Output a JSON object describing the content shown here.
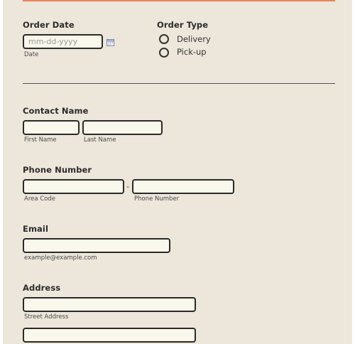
{
  "order_date": {
    "label": "Order Date",
    "placeholder": "mm-dd-yyyy",
    "value": "",
    "sublabel": "Date"
  },
  "order_type": {
    "label": "Order Type",
    "options": [
      {
        "label": "Delivery",
        "selected": false
      },
      {
        "label": "Pick-up",
        "selected": false
      }
    ]
  },
  "contact_name": {
    "label": "Contact Name",
    "first_sublabel": "First Name",
    "last_sublabel": "Last Name",
    "first_value": "",
    "last_value": ""
  },
  "phone_number": {
    "label": "Phone Number",
    "separator": "-",
    "area_sublabel": "Area Code",
    "number_sublabel": "Phone Number",
    "area_value": "",
    "number_value": ""
  },
  "email": {
    "label": "Email",
    "sublabel": "example@example.com",
    "value": ""
  },
  "address": {
    "label": "Address",
    "street_sublabel": "Street Address",
    "street_value": "",
    "line2_value": ""
  },
  "colors": {
    "background": "#ede6da",
    "accent_line": "#e8845c",
    "input_border": "#2a2a2a",
    "input_fill": "#faf7ec"
  },
  "icons": {
    "calendar": "calendar-icon"
  }
}
